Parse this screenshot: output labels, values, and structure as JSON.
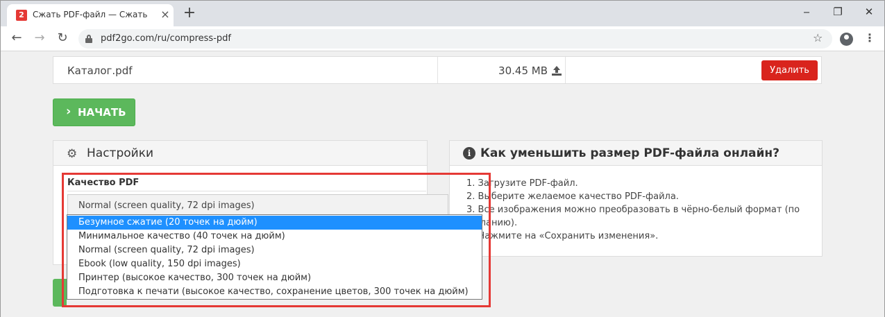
{
  "browser": {
    "tab_title": "Сжать PDF-файл — Сжать PDF-файл",
    "favicon_text": "2",
    "tab_close": "×",
    "new_tab": "+",
    "win_min": "‒",
    "win_max": "❐",
    "win_close": "✕",
    "url": "pdf2go.com/ru/compress-pdf",
    "back": "←",
    "forward": "→",
    "reload": "↻",
    "star": "☆",
    "menu": "⋮"
  },
  "file": {
    "name": "Каталог.pdf",
    "size": "30.45 MB",
    "delete_label": "Удалить"
  },
  "start": {
    "chevron": "›",
    "label": "НАЧАТЬ"
  },
  "settings": {
    "gear": "⚙",
    "title": "Настройки",
    "quality_label": "Качество PDF",
    "selected_value": "Normal (screen quality, 72 dpi images)"
  },
  "dropdown": {
    "options": [
      "Безумное сжатие (20 точек на дюйм)",
      "Минимальное качество (40 точек на дюйм)",
      "Normal (screen quality, 72 dpi images)",
      "Ebook (low quality, 150 dpi images)",
      "Принтер (высокое качество, 300 точек на дюйм)",
      "Подготовка к печати (высокое качество, сохранение цветов, 300 точек на дюйм)"
    ],
    "highlighted_index": 0
  },
  "help": {
    "info": "i",
    "title": "Как уменьшить размер PDF-файла онлайн?",
    "steps": [
      "1. Загрузите PDF-файл.",
      "2. Выберите желаемое качество PDF-файла.",
      "3. Все изображения можно преобразовать в чёрно-белый формат (по желанию).",
      "4. Нажмите на «Сохранить изменения»."
    ]
  },
  "colors": {
    "highlight": "#e53935",
    "start_green": "#5cb85c",
    "delete_red": "#d9241d",
    "selected_blue": "#1e90ff"
  }
}
